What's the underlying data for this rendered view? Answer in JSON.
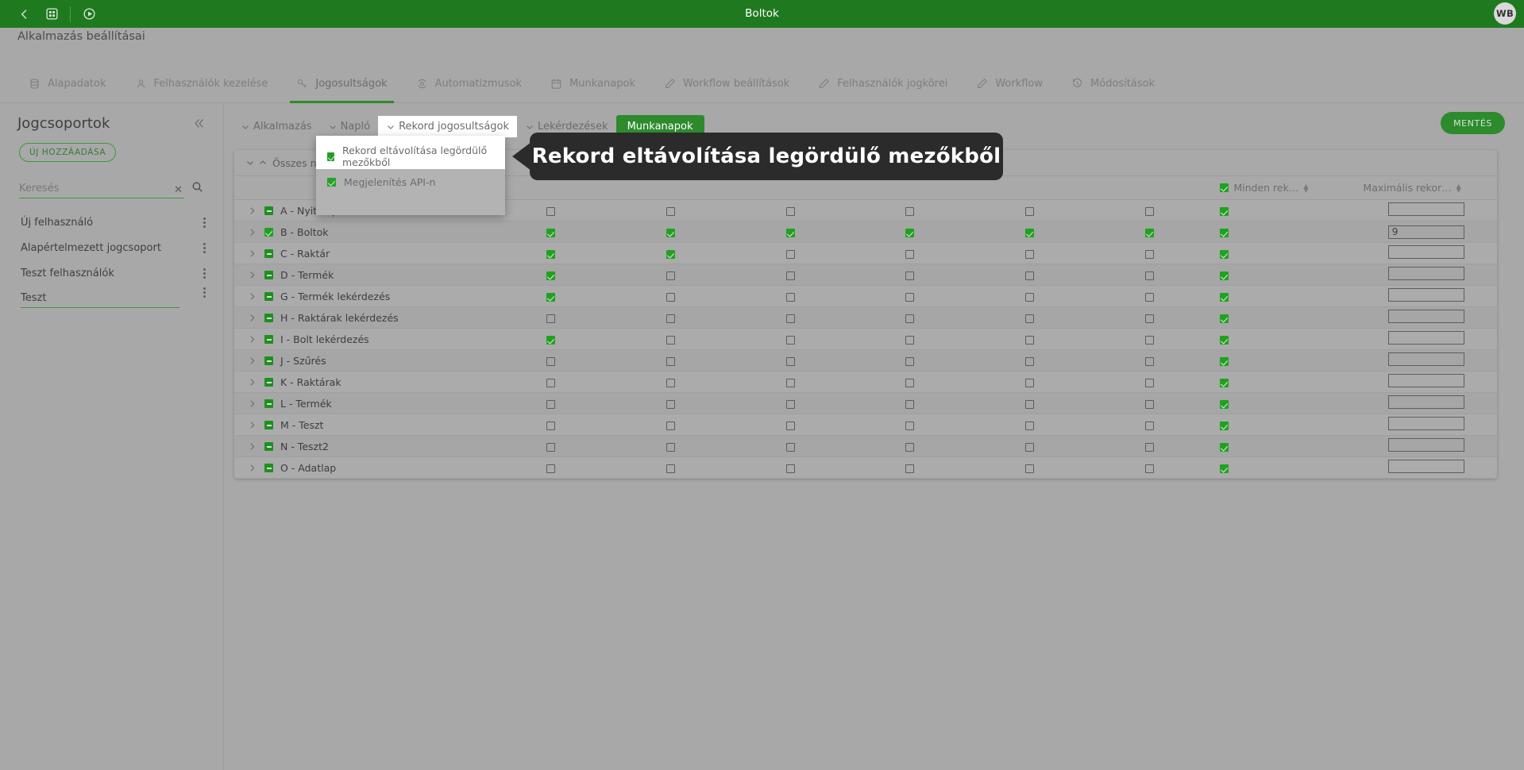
{
  "topbar": {
    "title": "Boltok",
    "back_icon": "back-chevron-icon",
    "grid_icon": "grid-apps-icon",
    "play_icon": "play-circle-icon",
    "avatar_initials": "WB",
    "accent": "#1f7a1f"
  },
  "page": {
    "title": "Alkalmazás beállításai"
  },
  "settings_tabs": [
    {
      "label": "Alapadatok",
      "icon": "database-icon",
      "active": false
    },
    {
      "label": "Felhasználók kezelése",
      "icon": "user-icon",
      "active": false
    },
    {
      "label": "Jogosultságok",
      "icon": "key-icon",
      "active": true
    },
    {
      "label": "Automatizmusok",
      "icon": "gear-cycle-icon",
      "active": false
    },
    {
      "label": "Munkanapok",
      "icon": "calendar-icon",
      "active": false
    },
    {
      "label": "Workflow beállítások",
      "icon": "pencil-icon",
      "active": false
    },
    {
      "label": "Felhasználók jogkörei",
      "icon": "pencil-icon",
      "active": false
    },
    {
      "label": "Workflow",
      "icon": "pencil-icon",
      "active": false
    },
    {
      "label": "Módosítások",
      "icon": "history-icon",
      "active": false
    }
  ],
  "sidebar": {
    "title": "Jogcsoportok",
    "collapse_icon": "double-chevron-left-icon",
    "add_button": "ÚJ HOZZÁADÁSA",
    "search": {
      "placeholder": "Keresés",
      "value": "",
      "clear_icon": "close-x-icon",
      "search_icon": "search-icon"
    },
    "groups": [
      {
        "label": "Új felhasználó",
        "editing": false
      },
      {
        "label": "Alapértelmezett jogcsoport",
        "editing": false
      },
      {
        "label": "Teszt felhasználók",
        "editing": false
      },
      {
        "label": "Teszt",
        "editing": true
      }
    ]
  },
  "content": {
    "subtabs": [
      {
        "label": "Alkalmazás",
        "style": "plain"
      },
      {
        "label": "Napló",
        "style": "plain"
      },
      {
        "label": "Rekord jogosultságok",
        "style": "open"
      },
      {
        "label": "Lekérdezések",
        "style": "plain"
      },
      {
        "label": "Munkanapok",
        "style": "green"
      }
    ],
    "save_label": "MENTÉS",
    "toolbar_label": "Összes nyitása/zárása"
  },
  "dropdown": {
    "items": [
      {
        "label": "Rekord eltávolítása legördülő mezőkből",
        "checked": true,
        "highlight": true
      },
      {
        "label": "Megjelenítés API-n",
        "checked": true,
        "highlight": false
      }
    ]
  },
  "tooltip": {
    "text": "Rekord eltávolítása legördülő mezőkből"
  },
  "table": {
    "columns": [
      {
        "key": "name",
        "label": ""
      },
      {
        "key": "c1",
        "label": ""
      },
      {
        "key": "c2",
        "label": ""
      },
      {
        "key": "c3",
        "label": ""
      },
      {
        "key": "c4",
        "label": ""
      },
      {
        "key": "c5",
        "label": ""
      },
      {
        "key": "c6",
        "label": ""
      },
      {
        "key": "c7",
        "label": "Minden rek…",
        "header_checked": true,
        "sortable": true
      },
      {
        "key": "max",
        "label": "Maximális rekor…",
        "sortable": true
      }
    ],
    "rows": [
      {
        "name": "A - Nyitólap",
        "state": "indet",
        "c": [
          false,
          false,
          false,
          false,
          false,
          false
        ],
        "all": true,
        "max": ""
      },
      {
        "name": "B - Boltok",
        "state": "checked",
        "c": [
          true,
          true,
          true,
          true,
          true,
          true
        ],
        "all": true,
        "max": "9"
      },
      {
        "name": "C - Raktár",
        "state": "indet",
        "c": [
          true,
          true,
          false,
          false,
          false,
          false
        ],
        "all": true,
        "max": ""
      },
      {
        "name": "D - Termék",
        "state": "indet",
        "c": [
          true,
          false,
          false,
          false,
          false,
          false
        ],
        "all": true,
        "max": ""
      },
      {
        "name": "G - Termék lekérdezés",
        "state": "indet",
        "c": [
          true,
          false,
          false,
          false,
          false,
          false
        ],
        "all": true,
        "max": ""
      },
      {
        "name": "H - Raktárak lekérdezés",
        "state": "indet",
        "c": [
          false,
          false,
          false,
          false,
          false,
          false
        ],
        "all": true,
        "max": ""
      },
      {
        "name": "I - Bolt lekérdezés",
        "state": "indet",
        "c": [
          true,
          false,
          false,
          false,
          false,
          false
        ],
        "all": true,
        "max": ""
      },
      {
        "name": "J - Szűrés",
        "state": "indet",
        "c": [
          false,
          false,
          false,
          false,
          false,
          false
        ],
        "all": true,
        "max": ""
      },
      {
        "name": "K - Raktárak",
        "state": "indet",
        "c": [
          false,
          false,
          false,
          false,
          false,
          false
        ],
        "all": true,
        "max": ""
      },
      {
        "name": "L - Termék",
        "state": "indet",
        "c": [
          false,
          false,
          false,
          false,
          false,
          false
        ],
        "all": true,
        "max": ""
      },
      {
        "name": "M - Teszt",
        "state": "indet",
        "c": [
          false,
          false,
          false,
          false,
          false,
          false
        ],
        "all": true,
        "max": ""
      },
      {
        "name": "N - Teszt2",
        "state": "indet",
        "c": [
          false,
          false,
          false,
          false,
          false,
          false
        ],
        "all": true,
        "max": ""
      },
      {
        "name": "O - Adatlap",
        "state": "indet",
        "c": [
          false,
          false,
          false,
          false,
          false,
          false
        ],
        "all": true,
        "max": ""
      }
    ]
  },
  "colors": {
    "brand_green": "#1f7a1f",
    "accent_green": "#2d8a2d",
    "check_green": "#22a022",
    "page_bg": "#a8a8a8",
    "tooltip_bg": "#2b2b2b"
  }
}
